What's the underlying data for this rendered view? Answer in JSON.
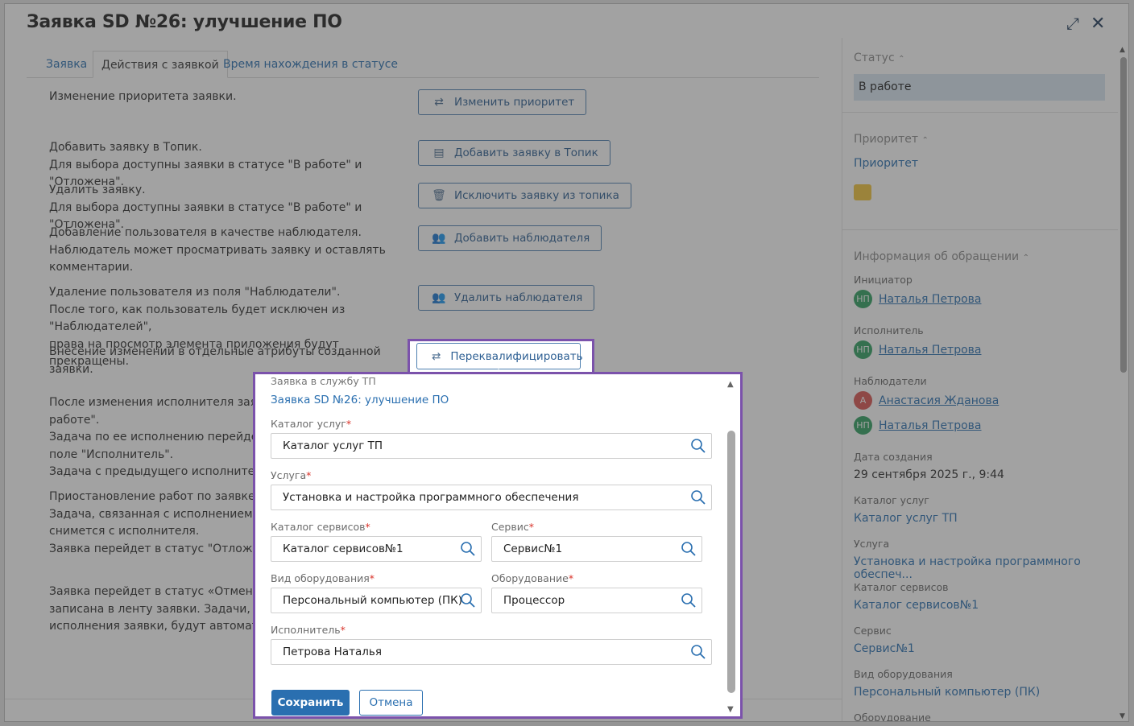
{
  "window": {
    "title": "Заявка SD №26: улучшение ПО"
  },
  "tabs": [
    {
      "label": "Заявка"
    },
    {
      "label": "Действия с заявкой"
    },
    {
      "label": "Время нахождения в статусе"
    }
  ],
  "actions": {
    "priority_text": "Изменение приоритета заявки.",
    "priority_btn": "Изменить приоритет",
    "topic_add_text_1": "Добавить заявку в Топик.",
    "topic_add_text_2": "Для выбора доступны заявки в статусе \"В работе\" и \"Отложена\".",
    "topic_add_btn": "Добавить заявку в Топик",
    "topic_del_text_1": "Удалить заявку.",
    "topic_del_text_2": "Для выбора доступны заявки в статусе \"В работе\" и \"Отложена\".",
    "topic_del_btn": "Исключить заявку из топика",
    "watcher_add_text_1": "Добавление пользователя в качестве наблюдателя.",
    "watcher_add_text_2": "Наблюдатель может просматривать заявку и оставлять",
    "watcher_add_text_3": "комментарии.",
    "watcher_add_btn": "Добавить наблюдателя",
    "watcher_del_text_1": "Удаление пользователя из поля \"Наблюдатели\".",
    "watcher_del_text_2": "После того, как пользователь будет исключен из \"Наблюдателей\",",
    "watcher_del_text_3": "права на просмотр элемента приложения будут прекращены.",
    "watcher_del_btn": "Удалить наблюдателя",
    "reclass_text": "Внесение изменений в отдельные атрибуты созданной заявки.",
    "reclass_btn": "Переквалифицировать",
    "exec_text_1": "После изменения исполнителя заявка о",
    "exec_text_2": "работе\".",
    "exec_text_3": "Задача по ее исполнению перейдет по",
    "exec_text_4": "поле \"Исполнитель\".",
    "exec_text_5": "Задача с предыдущего исполнителя сн",
    "pause_text_1": "Приостановление работ по заявке.",
    "pause_text_2": "Задача, связанная с исполнением этой",
    "pause_text_3": "снимется с исполнителя.",
    "pause_text_4": "Заявка перейдет в статус \"Отложена\".",
    "cancel_text_1": "Заявка перейдет в статус «Отменена»",
    "cancel_text_2": "записана в ленту заявки. Задачи, поста",
    "cancel_text_3": "исполнения заявки, будут автоматичес"
  },
  "sidebar": {
    "status_header": "Статус",
    "status_value": "В работе",
    "priority_header": "Приоритет",
    "priority_link": "Приоритет",
    "priority_color": "#f2c43a",
    "info_header": "Информация об обращении",
    "initiator_label": "Инициатор",
    "initiator_initials": "НП",
    "initiator_name": "Наталья Петрова",
    "executor_label": "Исполнитель",
    "executor_initials": "НП",
    "executor_name": "Наталья Петрова",
    "watchers_label": "Наблюдатели",
    "watcher1_initials": "А",
    "watcher1_name": "Анастасия Жданова",
    "watcher2_initials": "НП",
    "watcher2_name": "Наталья Петрова",
    "created_label": "Дата создания",
    "created_value": "29 сентября 2025 г., 9:44",
    "catalog_label": "Каталог услуг",
    "catalog_value": "Каталог услуг ТП",
    "service_label": "Услуга",
    "service_value": "Установка и настройка программного обеспеч...",
    "svc_catalog_label": "Каталог сервисов",
    "svc_catalog_value": "Каталог сервисов№1",
    "svc_label": "Сервис",
    "svc_value": "Сервис№1",
    "equip_type_label": "Вид оборудования",
    "equip_type_value": "Персональный компьютер (ПК)",
    "equip_label": "Оборудование"
  },
  "popup": {
    "header": "Заявка в службу ТП",
    "title": "Заявка SD №26: улучшение ПО",
    "catalog_label": "Каталог услуг",
    "catalog_value": "Каталог услуг ТП",
    "service_label": "Услуга",
    "service_value": "Установка и настройка программного обеспечения",
    "svc_catalog_label": "Каталог сервисов",
    "svc_catalog_value": "Каталог сервисов№1",
    "svc_label": "Сервис",
    "svc_value": "Сервис№1",
    "equip_type_label": "Вид оборудования",
    "equip_type_value": "Персональный компьютер (ПК)",
    "equip_label": "Оборудование",
    "equip_value": "Процессор",
    "executor_label": "Исполнитель",
    "executor_value": "Петрова Наталья",
    "required_mark": "*",
    "save": "Сохранить",
    "cancel": "Отмена"
  },
  "colors": {
    "accent": "#2a6fb0",
    "highlight": "#7b52ab",
    "required": "#d9332a"
  }
}
